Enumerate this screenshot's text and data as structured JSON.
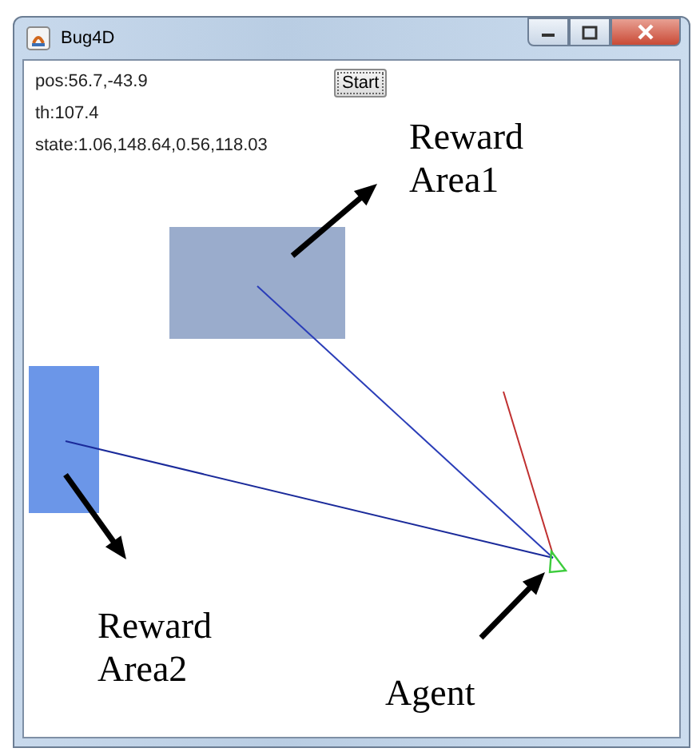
{
  "window": {
    "title": "Bug4D"
  },
  "readouts": [
    "pos:56.7,-43.9",
    "th:107.4",
    "state:1.06,148.64,0.56,118.03"
  ],
  "start_button": "Start",
  "reward_areas": [
    {
      "color": "#9aaccc"
    },
    {
      "color": "#6b96e8"
    }
  ],
  "annotations": [
    {
      "lines": [
        "Reward",
        "Area1"
      ]
    },
    {
      "lines": [
        "Reward",
        "Area2"
      ]
    },
    {
      "lines": [
        "Agent"
      ]
    }
  ]
}
